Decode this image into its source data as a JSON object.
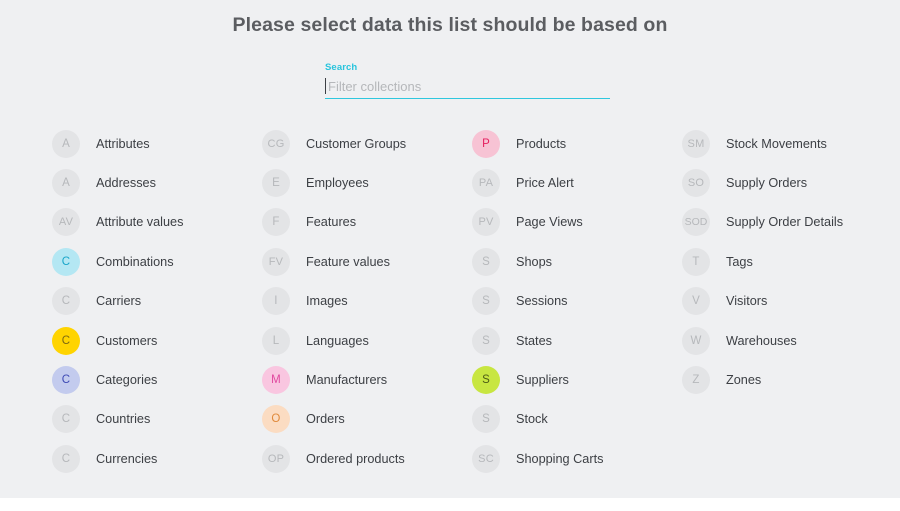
{
  "page": {
    "title": "Please select data this list should be based on",
    "background": "#eff0f2",
    "title_color": "#5b5d61"
  },
  "search": {
    "label": "Search",
    "value": "",
    "placeholder": "Filter collections",
    "accent_color": "#2fc7de"
  },
  "palette": {
    "default_bg": "#e3e4e6",
    "default_fg": "#b6b8bb",
    "cyan_bg": "#b4e7f3",
    "cyan_fg": "#1aa6c9",
    "yellow_bg": "#ffd400",
    "yellow_fg": "#7d6a12",
    "periwinkle_bg": "#c3cbee",
    "periwinkle_fg": "#3f4bb5",
    "pink_bg": "#f9c6e0",
    "pink_fg": "#e0489f",
    "peach_bg": "#fbdcc2",
    "peach_fg": "#e08a3c",
    "rose_bg": "#f7c3d4",
    "rose_fg": "#e51f5e",
    "lime_bg": "#c8e641",
    "lime_fg": "#4d5c16"
  },
  "columns": [
    {
      "name": "column-1",
      "items": [
        {
          "initials": "A",
          "label": "Attributes",
          "bg": "#e3e4e6",
          "fg": "#b6b8bb"
        },
        {
          "initials": "A",
          "label": "Addresses",
          "bg": "#e3e4e6",
          "fg": "#b6b8bb"
        },
        {
          "initials": "AV",
          "label": "Attribute values",
          "bg": "#e3e4e6",
          "fg": "#b6b8bb"
        },
        {
          "initials": "C",
          "label": "Combinations",
          "bg": "#b4e7f3",
          "fg": "#1aa6c9"
        },
        {
          "initials": "C",
          "label": "Carriers",
          "bg": "#e3e4e6",
          "fg": "#b6b8bb"
        },
        {
          "initials": "C",
          "label": "Customers",
          "bg": "#ffd400",
          "fg": "#7d6a12"
        },
        {
          "initials": "C",
          "label": "Categories",
          "bg": "#c3cbee",
          "fg": "#3f4bb5"
        },
        {
          "initials": "C",
          "label": "Countries",
          "bg": "#e3e4e6",
          "fg": "#b6b8bb"
        },
        {
          "initials": "C",
          "label": "Currencies",
          "bg": "#e3e4e6",
          "fg": "#b6b8bb"
        }
      ]
    },
    {
      "name": "column-2",
      "items": [
        {
          "initials": "CG",
          "label": "Customer Groups",
          "bg": "#e3e4e6",
          "fg": "#b6b8bb"
        },
        {
          "initials": "E",
          "label": "Employees",
          "bg": "#e3e4e6",
          "fg": "#b6b8bb"
        },
        {
          "initials": "F",
          "label": "Features",
          "bg": "#e3e4e6",
          "fg": "#b6b8bb"
        },
        {
          "initials": "FV",
          "label": "Feature values",
          "bg": "#e3e4e6",
          "fg": "#b6b8bb"
        },
        {
          "initials": "I",
          "label": "Images",
          "bg": "#e3e4e6",
          "fg": "#b6b8bb"
        },
        {
          "initials": "L",
          "label": "Languages",
          "bg": "#e3e4e6",
          "fg": "#b6b8bb"
        },
        {
          "initials": "M",
          "label": "Manufacturers",
          "bg": "#f9c6e0",
          "fg": "#e0489f"
        },
        {
          "initials": "O",
          "label": "Orders",
          "bg": "#fbdcc2",
          "fg": "#e08a3c"
        },
        {
          "initials": "OP",
          "label": "Ordered products",
          "bg": "#e3e4e6",
          "fg": "#b6b8bb"
        }
      ]
    },
    {
      "name": "column-3",
      "items": [
        {
          "initials": "P",
          "label": "Products",
          "bg": "#f7c3d4",
          "fg": "#e51f5e"
        },
        {
          "initials": "PA",
          "label": "Price Alert",
          "bg": "#e3e4e6",
          "fg": "#b6b8bb"
        },
        {
          "initials": "PV",
          "label": "Page Views",
          "bg": "#e3e4e6",
          "fg": "#b6b8bb"
        },
        {
          "initials": "S",
          "label": "Shops",
          "bg": "#e3e4e6",
          "fg": "#b6b8bb"
        },
        {
          "initials": "S",
          "label": "Sessions",
          "bg": "#e3e4e6",
          "fg": "#b6b8bb"
        },
        {
          "initials": "S",
          "label": "States",
          "bg": "#e3e4e6",
          "fg": "#b6b8bb"
        },
        {
          "initials": "S",
          "label": "Suppliers",
          "bg": "#c8e641",
          "fg": "#4d5c16"
        },
        {
          "initials": "S",
          "label": "Stock",
          "bg": "#e3e4e6",
          "fg": "#b6b8bb"
        },
        {
          "initials": "SC",
          "label": "Shopping Carts",
          "bg": "#e3e4e6",
          "fg": "#b6b8bb"
        }
      ]
    },
    {
      "name": "column-4",
      "items": [
        {
          "initials": "SM",
          "label": "Stock Movements",
          "bg": "#e3e4e6",
          "fg": "#b6b8bb"
        },
        {
          "initials": "SO",
          "label": "Supply Orders",
          "bg": "#e3e4e6",
          "fg": "#b6b8bb"
        },
        {
          "initials": "SOD",
          "label": "Supply Order Details",
          "bg": "#e3e4e6",
          "fg": "#b6b8bb"
        },
        {
          "initials": "T",
          "label": "Tags",
          "bg": "#e3e4e6",
          "fg": "#b6b8bb"
        },
        {
          "initials": "V",
          "label": "Visitors",
          "bg": "#e3e4e6",
          "fg": "#b6b8bb"
        },
        {
          "initials": "W",
          "label": "Warehouses",
          "bg": "#e3e4e6",
          "fg": "#b6b8bb"
        },
        {
          "initials": "Z",
          "label": "Zones",
          "bg": "#e3e4e6",
          "fg": "#b6b8bb"
        }
      ]
    }
  ]
}
